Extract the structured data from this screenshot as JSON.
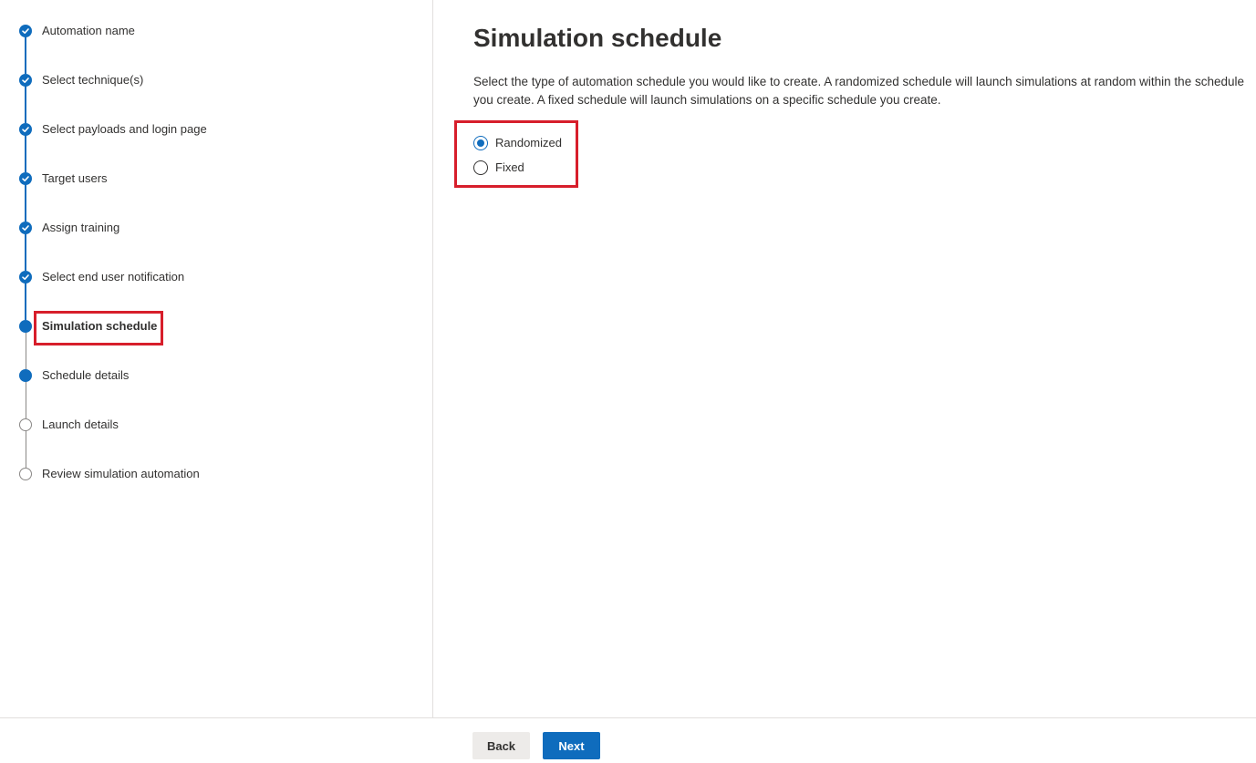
{
  "stepper": {
    "steps": [
      {
        "label": "Automation name",
        "state": "done"
      },
      {
        "label": "Select technique(s)",
        "state": "done"
      },
      {
        "label": "Select payloads and login page",
        "state": "done"
      },
      {
        "label": "Target users",
        "state": "done"
      },
      {
        "label": "Assign training",
        "state": "done"
      },
      {
        "label": "Select end user notification",
        "state": "done"
      },
      {
        "label": "Simulation schedule",
        "state": "current"
      },
      {
        "label": "Schedule details",
        "state": "current"
      },
      {
        "label": "Launch details",
        "state": "pending"
      },
      {
        "label": "Review simulation automation",
        "state": "pending"
      }
    ],
    "icons": {
      "done": "checkmark-circle-icon",
      "current": "filled-circle-icon",
      "pending": "empty-circle-icon"
    },
    "colors": {
      "accent": "#0f6cbd",
      "pending": "#8a8886",
      "highlight": "#d71e2b"
    }
  },
  "main": {
    "title": "Simulation schedule",
    "description": "Select the type of automation schedule you would like to create. A randomized schedule will launch simulations at random within the schedule you create. A fixed schedule will launch simulations on a specific schedule you create.",
    "options": [
      {
        "label": "Randomized",
        "checked": true
      },
      {
        "label": "Fixed",
        "checked": false
      }
    ]
  },
  "footer": {
    "back_label": "Back",
    "next_label": "Next"
  }
}
